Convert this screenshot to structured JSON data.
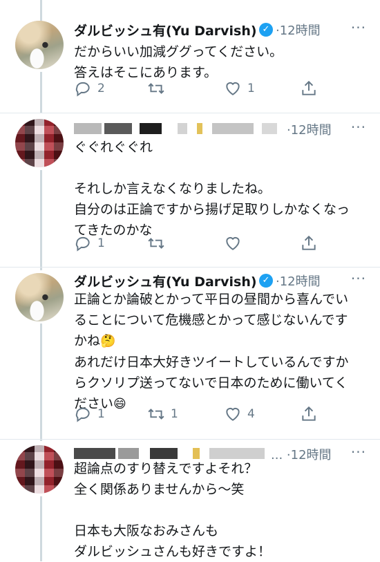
{
  "tweets": [
    {
      "author_name": "ダルビッシュ有(Yu Darvish)",
      "verified": true,
      "time": "12時間",
      "body": [
        "だからいい加減ググってください。",
        "答えはそこにあります。"
      ],
      "replies": "2",
      "retweets": "",
      "likes": "1"
    },
    {
      "author_name": "",
      "verified": false,
      "time": "12時間",
      "body": [
        "ぐぐれぐぐれ",
        "",
        "それしか言えなくなりましたね。",
        "自分のは正論ですから揚げ足取りしかなくなっ",
        "てきたのかな"
      ],
      "replies": "1",
      "retweets": "",
      "likes": ""
    },
    {
      "author_name": "ダルビッシュ有(Yu Darvish)",
      "verified": true,
      "time": "12時間",
      "body": [
        "正論とか論破とかって平日の昼間から喜んでい",
        "ることについて危機感とかって感じないんです",
        "かね",
        "あれだけ日本大好きツイートしているんですか",
        "らクソリプ送ってないで日本のために働いてく",
        "ださい"
      ],
      "emoji_1": "🤔",
      "emoji_2": "😄",
      "replies": "1",
      "retweets": "1",
      "likes": "4"
    },
    {
      "author_name": "...",
      "verified": false,
      "time": "12時間",
      "body": [
        "超論点のすり替えですよそれ？",
        "全く関係ありませんから〜笑",
        "",
        "日本も大阪なおみさんも",
        "ダルビッシュさんも好きですよ！"
      ]
    }
  ],
  "icons": {
    "more": "more-icon",
    "reply": "reply-icon",
    "retweet": "retweet-icon",
    "like": "heart-icon",
    "share": "share-icon",
    "verified": "verified-badge-icon"
  },
  "colors": {
    "verified": "#1da1f2",
    "meta": "#657786",
    "thread_line": "#cfd9de"
  },
  "verified_glyph": "✓",
  "more_glyph": "···",
  "separator": "·"
}
